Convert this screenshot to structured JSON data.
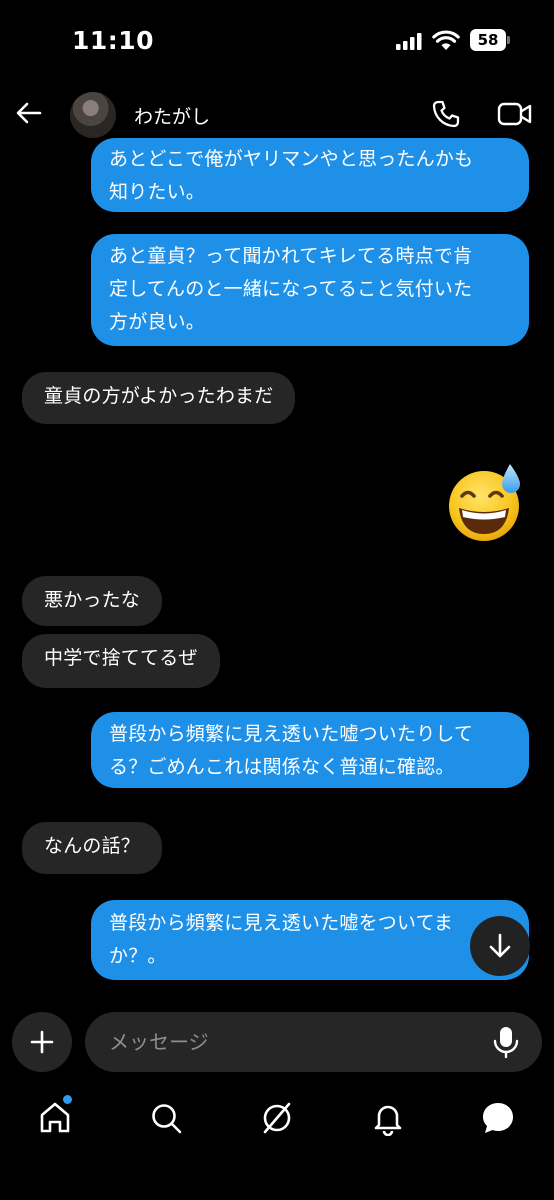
{
  "status_bar": {
    "time": "11:10",
    "battery": "58"
  },
  "header": {
    "contact_name": "わたがし"
  },
  "messages": [
    {
      "from": "me",
      "lines": [
        "あとどこで俺がヤリマンやと思ったんかも",
        "知りたい。"
      ]
    },
    {
      "from": "me",
      "lines": [
        "あと童貞？って聞かれてキレてる時点で肯",
        "定してんのと一緒になってること気付いた",
        "方が良い。"
      ]
    },
    {
      "from": "them",
      "lines": [
        "童貞の方がよかったわまだ"
      ]
    },
    {
      "from": "me",
      "emoji": "grinning-face-with-sweat"
    },
    {
      "from": "them",
      "lines": [
        "悪かったな"
      ]
    },
    {
      "from": "them",
      "lines": [
        "中学で捨ててるぜ"
      ]
    },
    {
      "from": "me",
      "lines": [
        "普段から頻繁に見え透いた嘘ついたりして",
        "る？ごめんこれは関係なく普通に確認。"
      ]
    },
    {
      "from": "them",
      "lines": [
        "なんの話？"
      ]
    },
    {
      "from": "me",
      "lines": [
        "普段から頻繁に見え透いた嘘をついてま",
        "か？。"
      ]
    }
  ],
  "composer": {
    "placeholder": "メッセージ"
  },
  "nav": {
    "items": [
      "home-icon",
      "search-icon",
      "explore-icon",
      "notifications-icon",
      "messages-icon"
    ]
  },
  "colors": {
    "outgoing_bubble": "#1e90e8",
    "incoming_bubble": "#262626",
    "background": "#000000",
    "notification_dot": "#2f9bf0"
  }
}
